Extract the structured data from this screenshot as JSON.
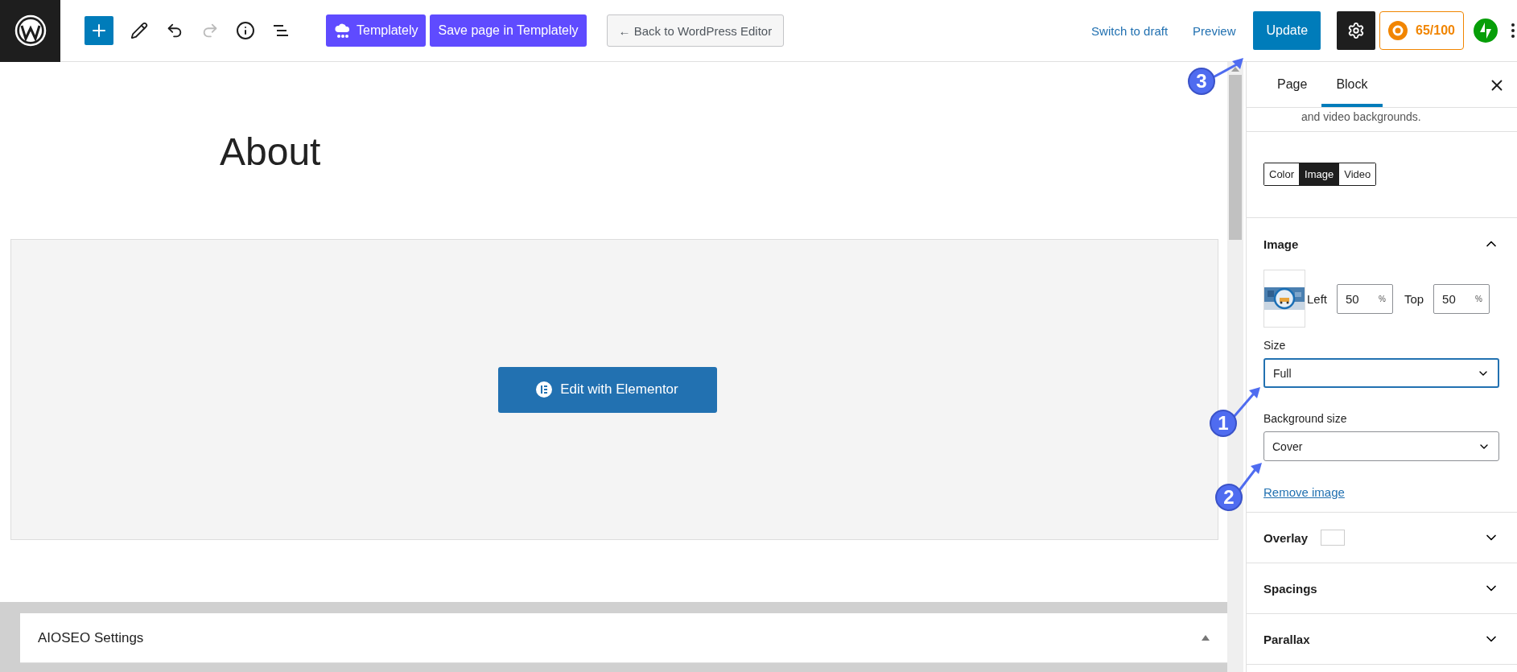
{
  "toolbar": {
    "undo": {
      "disabled": false
    },
    "redo": {
      "disabled": true
    },
    "templately_button": "Templately",
    "save_templately_button": "Save page in Templately",
    "back_button": "← Back to WordPress Editor",
    "switch_draft_link": "Switch to draft",
    "preview_link": "Preview",
    "update_button": "Update",
    "settings_active": true,
    "seo_score": "65/100"
  },
  "editor": {
    "title": "About",
    "elementor_button": "Edit with Elementor"
  },
  "meta_box": {
    "title": "AIOSEO Settings",
    "expanded": true
  },
  "sidebar": {
    "tabs": [
      {
        "label": "Page",
        "selected": false
      },
      {
        "label": "Block",
        "selected": true
      }
    ],
    "clipped_text": "and video backgrounds.",
    "background_types": [
      {
        "label": "Color",
        "selected": false
      },
      {
        "label": "Image",
        "selected": true
      },
      {
        "label": "Video",
        "selected": false
      }
    ],
    "image_section": {
      "title": "Image",
      "expanded": true,
      "position": [
        {
          "label": "Left",
          "value": "50",
          "unit": "%"
        },
        {
          "label": "Top",
          "value": "50",
          "unit": "%"
        }
      ],
      "size": {
        "label": "Size",
        "value": "Full",
        "focused": true
      },
      "background_size": {
        "label": "Background size",
        "value": "Cover",
        "focused": false
      },
      "remove_link": "Remove image"
    },
    "panels": [
      {
        "title": "Overlay",
        "kind": "swatch",
        "color": "#ffffff"
      },
      {
        "title": "Spacings",
        "kind": "plain"
      },
      {
        "title": "Parallax",
        "kind": "plain"
      }
    ]
  },
  "callouts": [
    {
      "label": "3"
    },
    {
      "label": "1"
    },
    {
      "label": "2"
    }
  ]
}
